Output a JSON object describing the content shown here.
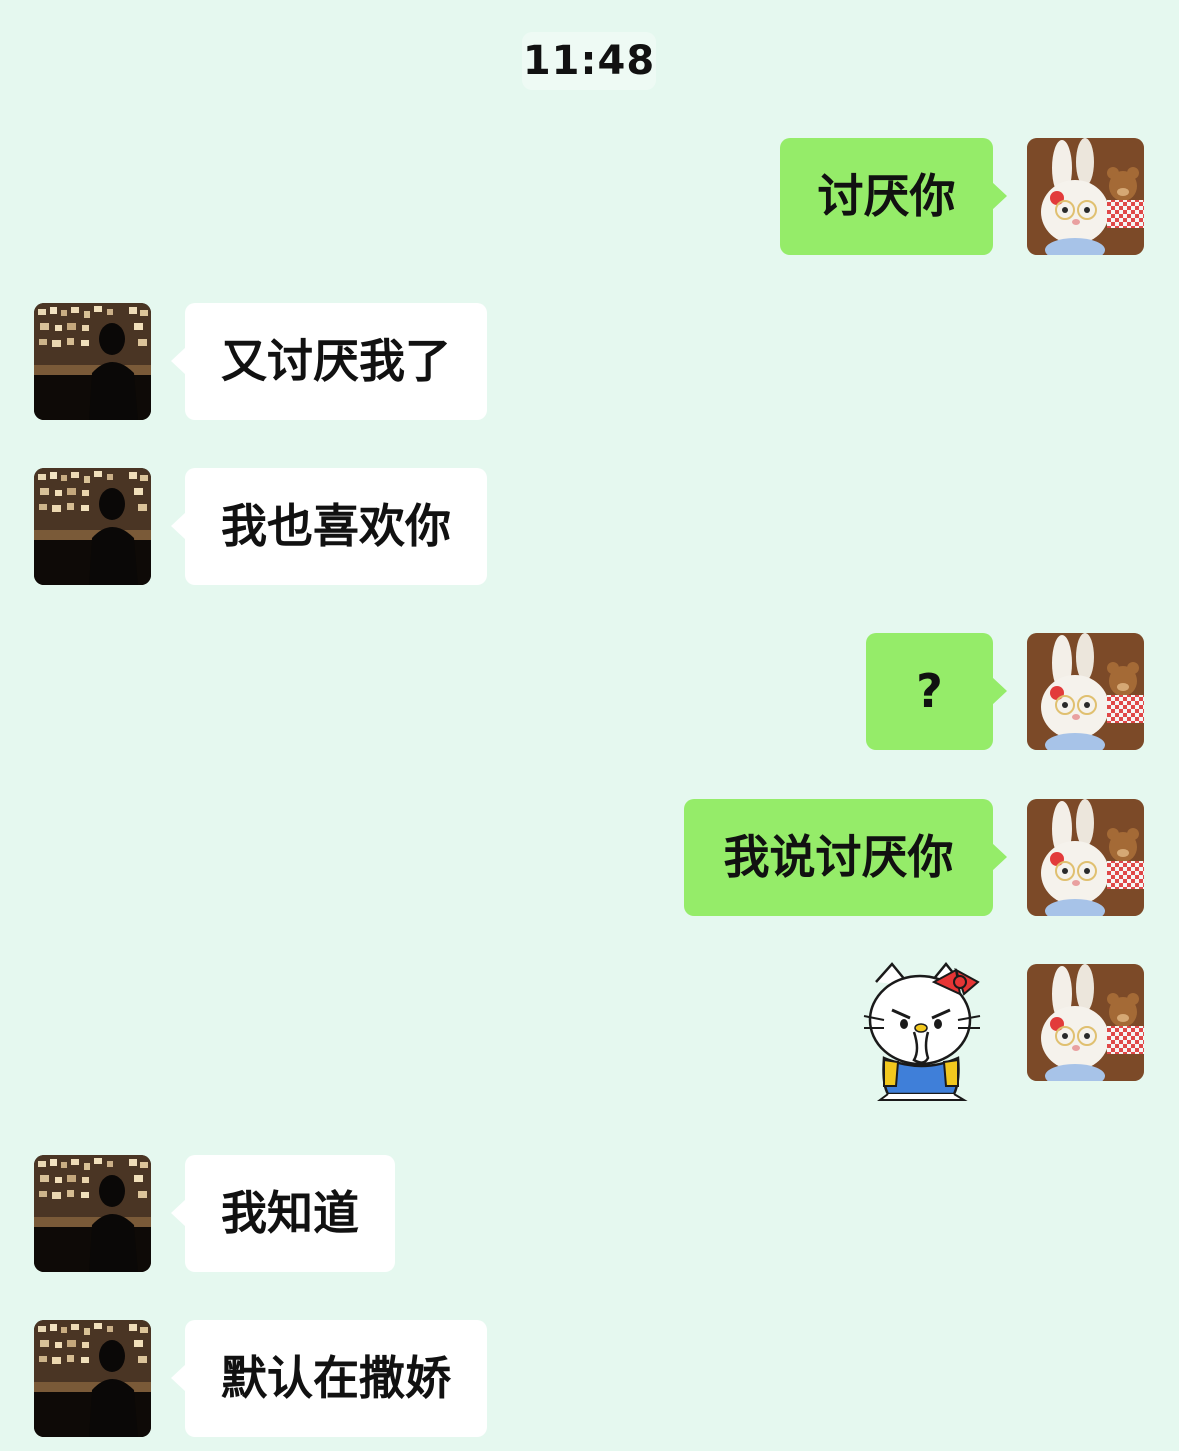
{
  "chat": {
    "timestamp": "11:48",
    "messages": [
      {
        "side": "right",
        "text": "讨厌你"
      },
      {
        "side": "left",
        "text": "又讨厌我了"
      },
      {
        "side": "left",
        "text": "我也喜欢你"
      },
      {
        "side": "right",
        "text": "?"
      },
      {
        "side": "right",
        "text": "我说讨厌你"
      },
      {
        "side": "right",
        "sticker": "hello-kitty-angry-sticker"
      },
      {
        "side": "left",
        "text": "我知道"
      },
      {
        "side": "left",
        "text": "默认在撒娇"
      }
    ]
  },
  "colors": {
    "background": "#e5f8ef",
    "incoming_bubble": "#ffffff",
    "outgoing_bubble": "#95ec69"
  },
  "icons": {
    "self_avatar": "plush-bunny-avatar",
    "other_avatar": "dark-cafe-person-avatar",
    "sticker": "hello-kitty-angry-sticker"
  }
}
